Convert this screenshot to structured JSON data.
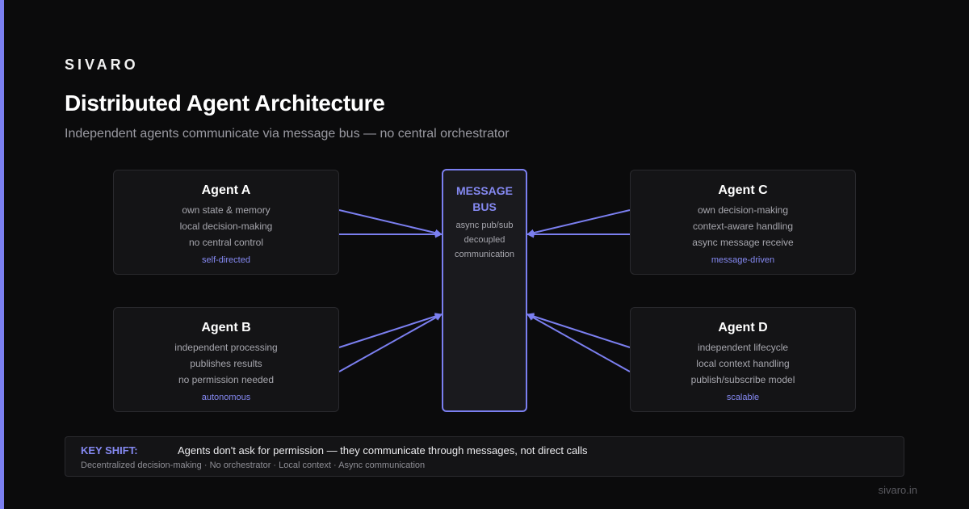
{
  "brand": "SIVARO",
  "title": "Distributed Agent Architecture",
  "subtitle": "Independent agents communicate via message bus — no central orchestrator",
  "agents": [
    {
      "name": "Agent A",
      "lines": [
        "own state & memory",
        "local decision-making",
        "no central control"
      ],
      "tag": "self-directed"
    },
    {
      "name": "Agent B",
      "lines": [
        "independent processing",
        "publishes results",
        "no permission needed"
      ],
      "tag": "autonomous"
    },
    {
      "name": "Agent C",
      "lines": [
        "own decision-making",
        "context-aware handling",
        "async message receive"
      ],
      "tag": "message-driven"
    },
    {
      "name": "Agent D",
      "lines": [
        "independent lifecycle",
        "local context handling",
        "publish/subscribe model"
      ],
      "tag": "scalable"
    }
  ],
  "bus": {
    "title_lines": [
      "MESSAGE",
      "BUS"
    ],
    "lines": [
      "async pub/sub",
      "decoupled",
      "communication"
    ]
  },
  "key_shift": {
    "label": "KEY SHIFT:",
    "message": "Agents don't ask for permission — they communicate through messages, not direct calls",
    "detail": "Decentralized decision-making · No orchestrator · Local context · Async communication"
  },
  "footer": "sivaro.in",
  "colors": {
    "accent": "#7b7ff0",
    "background": "#0b0b0c",
    "card": "#141416",
    "card_border": "#2a2a2e"
  }
}
